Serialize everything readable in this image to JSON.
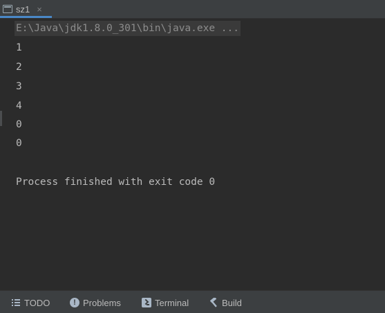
{
  "tab": {
    "label": "sz1",
    "close_glyph": "×",
    "icon": "console-window-icon"
  },
  "console": {
    "command": "E:\\Java\\jdk1.8.0_301\\bin\\java.exe ...",
    "output_lines": [
      "1",
      "2",
      "3",
      "4",
      "0",
      "0"
    ],
    "exit_message": "Process finished with exit code 0"
  },
  "statusbar": {
    "todo": "TODO",
    "problems": "Problems",
    "problems_glyph": "!",
    "terminal": "Terminal",
    "build": "Build"
  },
  "colors": {
    "background": "#2b2b2b",
    "toolbar": "#3c3f41",
    "text": "#bbbbbb",
    "accent": "#4a88c7"
  }
}
